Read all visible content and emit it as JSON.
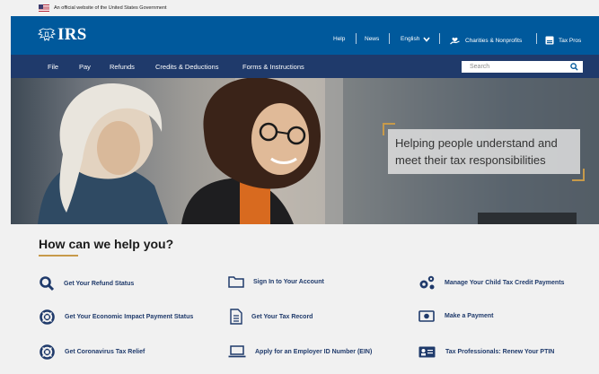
{
  "gov_banner": {
    "text": "An official website of the United States Government"
  },
  "header": {
    "logo_text": "IRS",
    "utility_links": {
      "help": "Help",
      "news": "News",
      "language": "English",
      "charities": "Charities & Nonprofits",
      "tax_pros": "Tax Pros"
    }
  },
  "nav": {
    "items": [
      "File",
      "Pay",
      "Refunds",
      "Credits & Deductions",
      "Forms & Instructions"
    ],
    "search_placeholder": "Search"
  },
  "hero": {
    "line1": "Helping people understand and",
    "line2": "meet their tax responsibilities"
  },
  "help_section": {
    "title": "How can we help you?",
    "links": [
      {
        "label": "Get Your Refund Status",
        "icon": "search-icon"
      },
      {
        "label": "Sign In to Your Account",
        "icon": "folder-icon"
      },
      {
        "label": "Manage Your Child Tax Credit Payments",
        "icon": "gears-icon"
      },
      {
        "label": "Get Your Economic Impact Payment Status",
        "icon": "lifebuoy-icon"
      },
      {
        "label": "Get Your Tax Record",
        "icon": "document-icon"
      },
      {
        "label": "Make a Payment",
        "icon": "money-icon"
      },
      {
        "label": "Get Coronavirus Tax Relief",
        "icon": "lifebuoy-icon"
      },
      {
        "label": "Apply for an Employer ID Number (EIN)",
        "icon": "laptop-icon"
      },
      {
        "label": "Tax Professionals: Renew Your PTIN",
        "icon": "id-card-icon"
      }
    ]
  },
  "colors": {
    "header_blue": "#00599c",
    "nav_navy": "#1f3a6b",
    "accent_gold": "#c79a4a"
  }
}
